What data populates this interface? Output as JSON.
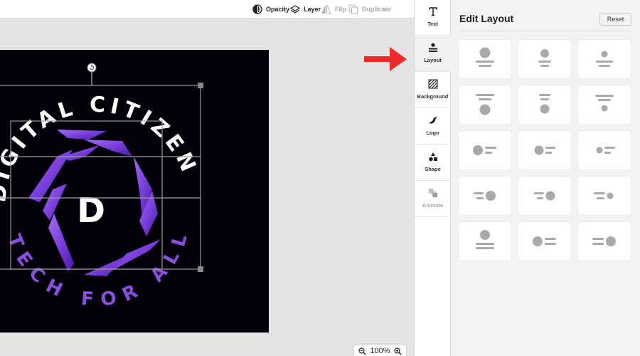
{
  "toolbar": {
    "opacity_label": "Opacity",
    "layer_label": "Layer",
    "flip_label": "Flip",
    "duplicate_label": "Duplicate"
  },
  "rail": {
    "items": [
      {
        "label": "Text",
        "icon": "text-icon"
      },
      {
        "label": "Layout",
        "icon": "layout-icon",
        "active": true
      },
      {
        "label": "Background",
        "icon": "background-icon"
      },
      {
        "label": "Logo",
        "icon": "logo-bird-icon"
      },
      {
        "label": "Shape",
        "icon": "shapes-icon"
      },
      {
        "label": "Animate",
        "icon": "animate-icon",
        "disabled": true
      }
    ]
  },
  "panel": {
    "title": "Edit Layout",
    "reset_label": "Reset",
    "layouts": [
      "icon-top-large-text-below",
      "icon-top-medium-text-below",
      "icon-top-small-text-below",
      "text-top-large-icon-below",
      "text-top-medium-icon-below",
      "text-top-small-icon-below",
      "icon-left-large-text-right",
      "icon-left-medium-text-right",
      "icon-left-small-text-right",
      "text-left-large-icon-right",
      "text-left-medium-icon-right",
      "text-left-small-icon-right",
      "icon-top-text-below-wide",
      "icon-left-text-right-wide",
      "text-left-icon-right-wide"
    ]
  },
  "canvas": {
    "logo_text_top": "DIGITAL CITIZEN",
    "logo_text_bottom": "TECH FOR ALL",
    "logo_letter": "D",
    "background_color": "#04000a",
    "accent_color": "#8a4fe0"
  },
  "zoom": {
    "level": "100%"
  },
  "colors": {
    "arrow": "#ee2b2b",
    "placeholder": "#a9a9a9"
  }
}
